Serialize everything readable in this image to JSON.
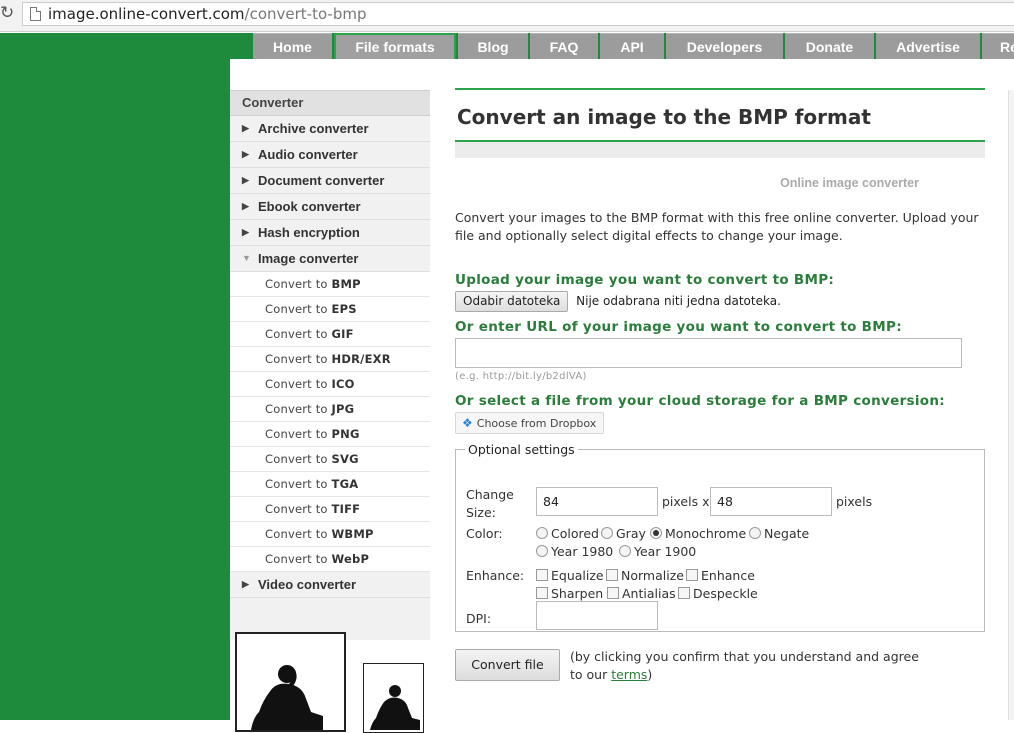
{
  "browser": {
    "url_host": "image.online-convert.com",
    "url_path": "/convert-to-bmp"
  },
  "nav": {
    "tabs": [
      "Home",
      "File formats",
      "Blog",
      "FAQ",
      "API",
      "Developers",
      "Donate",
      "Advertise",
      "Re"
    ],
    "active": "File formats"
  },
  "sidebar": {
    "header": "Converter",
    "categories_before": [
      "Archive converter",
      "Audio converter",
      "Document converter",
      "Ebook converter",
      "Hash encryption"
    ],
    "open_category": "Image converter",
    "sub_prefix": "Convert to",
    "subitems": [
      "BMP",
      "EPS",
      "GIF",
      "HDR/EXR",
      "ICO",
      "JPG",
      "PNG",
      "SVG",
      "TGA",
      "TIFF",
      "WBMP",
      "WebP"
    ],
    "categories_after": [
      "Video converter"
    ]
  },
  "main": {
    "title": "Convert an image to the BMP format",
    "subtitle": "Online image converter",
    "intro": "Convert your images to the BMP format with this free online converter. Upload your file and optionally select digital effects to change your image.",
    "upload_label": "Upload your image you want to convert to BMP:",
    "file_button": "Odabir datoteka",
    "file_status": "Nije odabrana niti jedna datoteka.",
    "url_label": "Or enter URL of your image you want to convert to BMP:",
    "url_value": "",
    "url_hint": "(e.g. http://bit.ly/b2dlVA)",
    "cloud_label": "Or select a file from your cloud storage for a BMP conversion:",
    "dropbox_button": "Choose from Dropbox"
  },
  "options": {
    "legend": "Optional settings",
    "size_label_1": "Change",
    "size_label_2": "Size:",
    "width": "84",
    "height": "48",
    "pixels_x": "pixels x",
    "pixels": "pixels",
    "color_label": "Color:",
    "colors": [
      "Colored",
      "Gray",
      "Monochrome",
      "Negate",
      "Year 1980",
      "Year 1900"
    ],
    "color_selected": "Monochrome",
    "enhance_label": "Enhance:",
    "enhance": [
      "Equalize",
      "Normalize",
      "Enhance",
      "Sharpen",
      "Antialias",
      "Despeckle"
    ],
    "dpi_label": "DPI:",
    "dpi_value": ""
  },
  "footer": {
    "convert_button": "Convert file",
    "agree_text_1": "(by clicking you confirm that you understand and agree",
    "agree_text_2": "to our",
    "terms_link": "terms",
    "agree_close": ")"
  },
  "colors": {
    "brand_green": "#1e8a3c",
    "label_green": "#2b7d3b",
    "tab_gray": "#9c9c9c"
  }
}
